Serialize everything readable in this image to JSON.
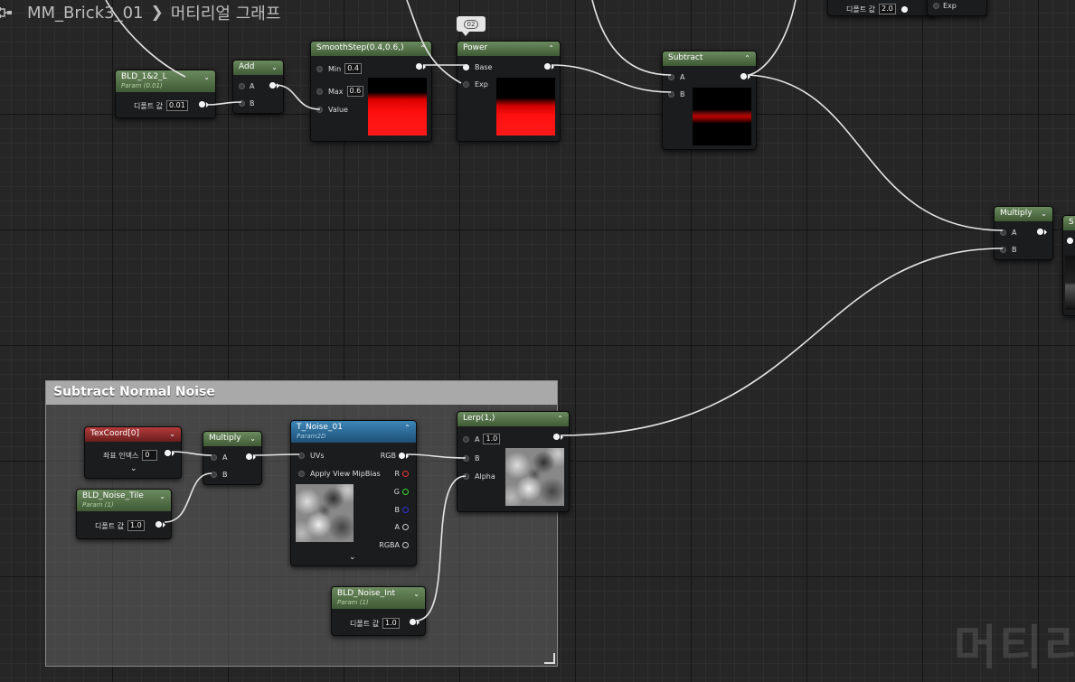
{
  "breadcrumb": {
    "asset": "MM_Brick3_01",
    "graph": "머티리얼 그래프"
  },
  "watermark": "머티리얼",
  "comment_box": {
    "title": "Subtract Normal Noise"
  },
  "bubble": {
    "text": "02"
  },
  "top_clipped": {
    "label": "디폴트 값",
    "value": "2.0",
    "exp": "Exp"
  },
  "nodes": {
    "bld12": {
      "title": "BLD_1&2_L",
      "subtitle": "Param (0.01)",
      "label": "디폴트 값",
      "value": "0.01"
    },
    "add": {
      "title": "Add",
      "a": "A",
      "b": "B"
    },
    "smoothstep": {
      "title": "SmoothStep(0.4,0.6,)",
      "min": "Min",
      "min_val": "0.4",
      "max": "Max",
      "max_val": "0.6",
      "value": "Value"
    },
    "power": {
      "title": "Power",
      "base": "Base",
      "exp": "Exp"
    },
    "subtract": {
      "title": "Subtract",
      "a": "A",
      "b": "B"
    },
    "multiply_right": {
      "title": "Multiply",
      "a": "A",
      "b": "B"
    },
    "right_clipped": {
      "title": "S"
    },
    "texcoord": {
      "title": "TexCoord[0]",
      "label": "좌표 인덱스",
      "value": "0"
    },
    "noise_tile": {
      "title": "BLD_Noise_Tile",
      "subtitle": "Param (1)",
      "label": "디폴트 값",
      "value": "1.0"
    },
    "multiply_left": {
      "title": "Multiply",
      "a": "A",
      "b": "B"
    },
    "t_noise": {
      "title": "T_Noise_01",
      "subtitle": "Param2D",
      "uvs": "UVs",
      "mip": "Apply View MipBias",
      "rgb": "RGB",
      "r": "R",
      "g": "G",
      "bch": "B",
      "a": "A",
      "rgba": "RGBA"
    },
    "lerp": {
      "title": "Lerp(1,)",
      "a": "A",
      "a_val": "1.0",
      "b": "B",
      "alpha": "Alpha"
    },
    "noise_int": {
      "title": "BLD_Noise_Int",
      "subtitle": "Param (1)",
      "label": "디폴트 값",
      "value": "1.0"
    }
  },
  "colors": {
    "parameter_header": "#5c7a4f",
    "texcoord_header": "#9a2f2f",
    "texture_header": "#2f6e9c",
    "wire": "#e6e6e6"
  }
}
